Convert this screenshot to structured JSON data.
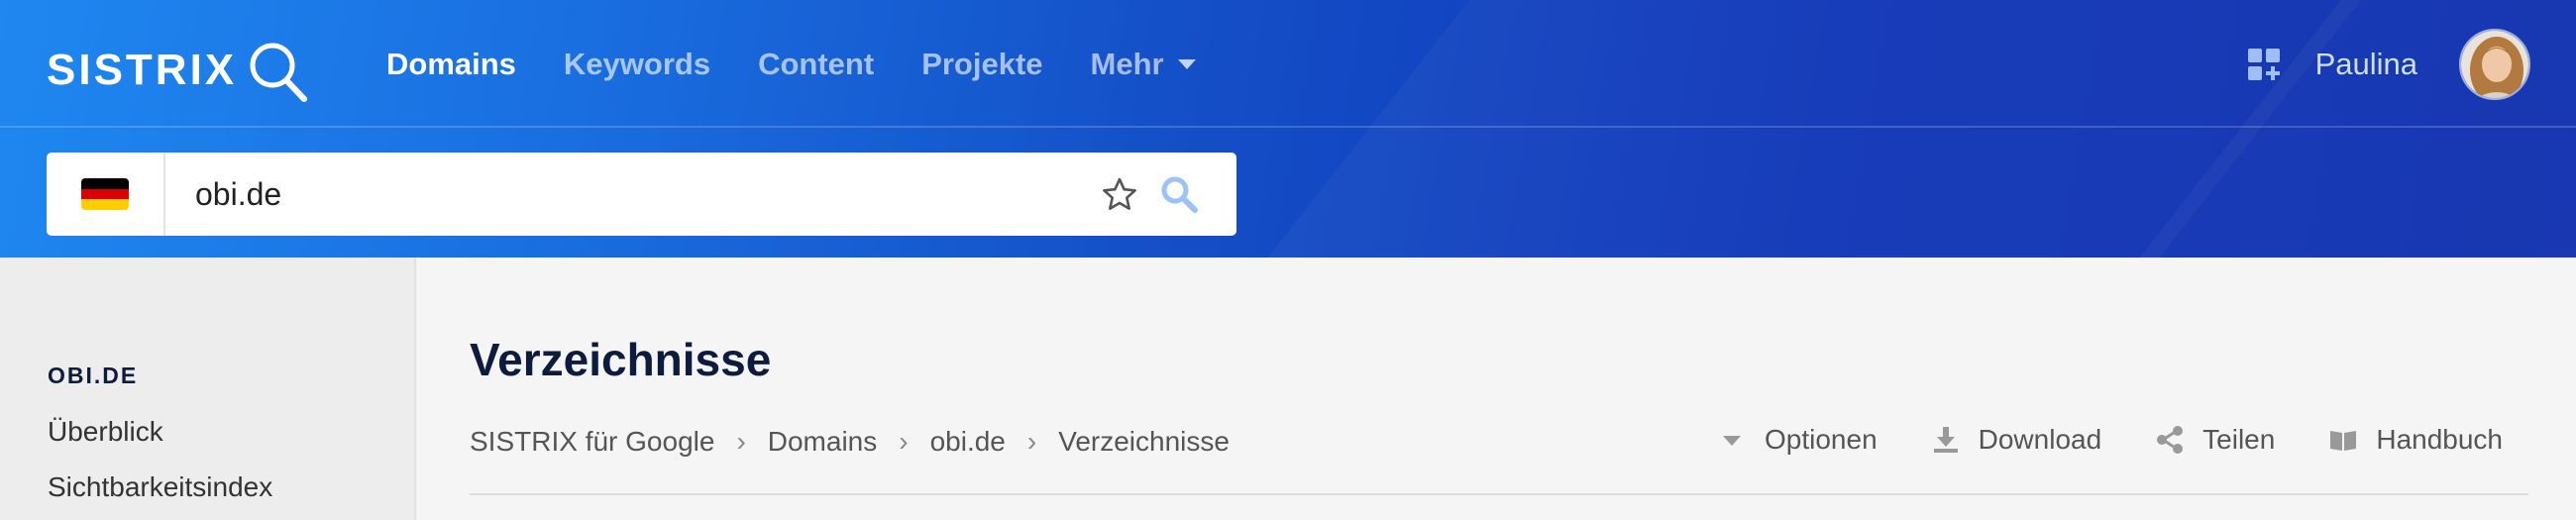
{
  "header": {
    "logo_text": "SISTRIX",
    "nav": [
      {
        "label": "Domains",
        "active": true
      },
      {
        "label": "Keywords",
        "active": false
      },
      {
        "label": "Content",
        "active": false
      },
      {
        "label": "Projekte",
        "active": false
      },
      {
        "label": "Mehr",
        "active": false,
        "has_dropdown": true
      }
    ],
    "user_name": "Paulina",
    "icons": {
      "logo": "magnifier-logo-icon",
      "apps": "apps-grid-icon",
      "avatar": "user-avatar"
    }
  },
  "search": {
    "country_flag": "de-flag-icon",
    "value": "obi.de",
    "icons": {
      "favorite": "star-icon",
      "submit": "search-icon"
    }
  },
  "sidebar": {
    "heading": "OBI.DE",
    "items": [
      {
        "label": "Überblick"
      },
      {
        "label": "Sichtbarkeitsindex"
      }
    ]
  },
  "content": {
    "title": "Verzeichnisse",
    "breadcrumb": [
      "SISTRIX für Google",
      "Domains",
      "obi.de",
      "Verzeichnisse"
    ],
    "actions": [
      {
        "label": "Optionen",
        "icon": "caret-down-icon"
      },
      {
        "label": "Download",
        "icon": "download-icon"
      },
      {
        "label": "Teilen",
        "icon": "share-icon"
      },
      {
        "label": "Handbuch",
        "icon": "book-icon"
      }
    ]
  },
  "colors": {
    "header_start": "#1f87f0",
    "header_end": "#0f2fae",
    "title": "#0d1b3e",
    "flag": [
      "#000000",
      "#dd0000",
      "#ffce00"
    ]
  }
}
